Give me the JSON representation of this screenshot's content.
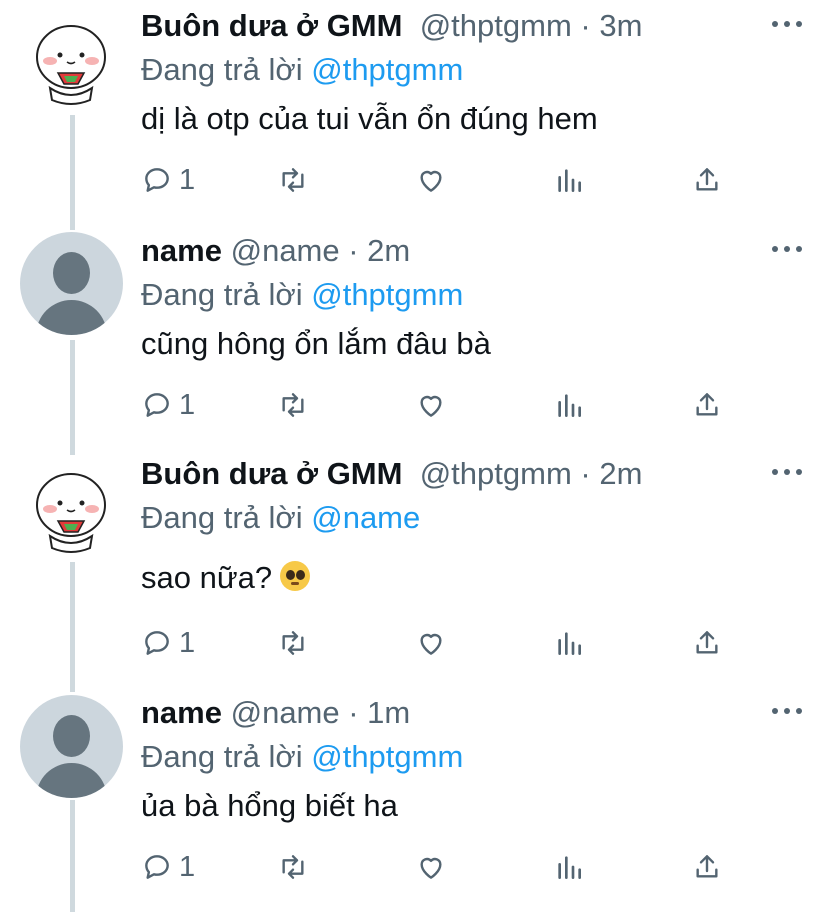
{
  "tweets": [
    {
      "name": "Buôn dưa ở GMM",
      "handle": "@thptgmm",
      "time": " · 3m",
      "replying_prefix": "Đang trả lời ",
      "replying_to": "@thptgmm",
      "text": "dị là otp của tui vẫn ổn đúng hem",
      "reply_count": "1",
      "avatar": "mochi-avatar"
    },
    {
      "name": "name",
      "handle": "@name",
      "time": " · 2m",
      "replying_prefix": "Đang trả lời ",
      "replying_to": "@thptgmm",
      "text": "cũng hông ổn lắm đâu bà",
      "reply_count": "1",
      "avatar": "default-avatar"
    },
    {
      "name": "Buôn dưa ở GMM",
      "handle": "@thptgmm",
      "time": " · 2m",
      "replying_prefix": "Đang trả lời ",
      "replying_to": "@name",
      "text": "sao nữa?",
      "text_emoji": "pleading-face-emoji",
      "reply_count": "1",
      "avatar": "mochi-avatar"
    },
    {
      "name": "name",
      "handle": "@name",
      "time": " · 1m",
      "replying_prefix": "Đang trả lời ",
      "replying_to": "@thptgmm",
      "text": "ủa bà hổng biết ha",
      "reply_count": "1",
      "avatar": "default-avatar"
    }
  ],
  "icons": {
    "reply": "reply-icon",
    "retweet": "retweet-icon",
    "like": "like-icon",
    "views": "analytics-icon",
    "share": "share-icon",
    "more": "more-icon"
  },
  "colors": {
    "link": "#1d9bf0",
    "secondary": "#536471",
    "thread_line": "#cfd9de"
  }
}
